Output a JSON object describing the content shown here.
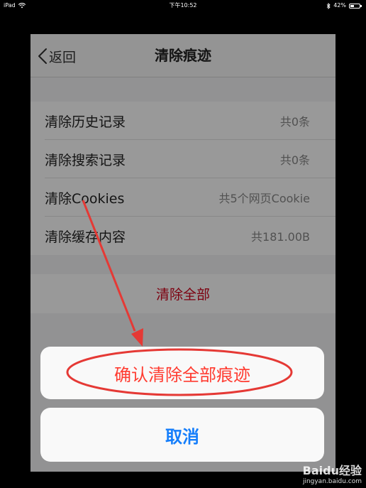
{
  "status_bar": {
    "device": "iPad",
    "time": "下午10:52",
    "battery": "42%",
    "battery_level": 0.42
  },
  "nav": {
    "back_label": "返回",
    "title": "清除痕迹"
  },
  "list": {
    "items": [
      {
        "label": "清除历史记录",
        "value": "共0条"
      },
      {
        "label": "清除搜索记录",
        "value": "共0条"
      },
      {
        "label": "清除Cookies",
        "value": "共5个网页Cookie"
      },
      {
        "label": "清除缓存内容",
        "value": "共181.00B"
      }
    ]
  },
  "clear_all_label": "清除全部",
  "action_sheet": {
    "confirm_label": "确认清除全部痕迹",
    "cancel_label": "取消"
  },
  "colors": {
    "destructive": "#ff3b30",
    "link_blue": "#157efb",
    "annotation_red": "#e53935"
  },
  "watermark": {
    "main": "Baidu经验",
    "sub": "jingyan.baidu.com"
  }
}
